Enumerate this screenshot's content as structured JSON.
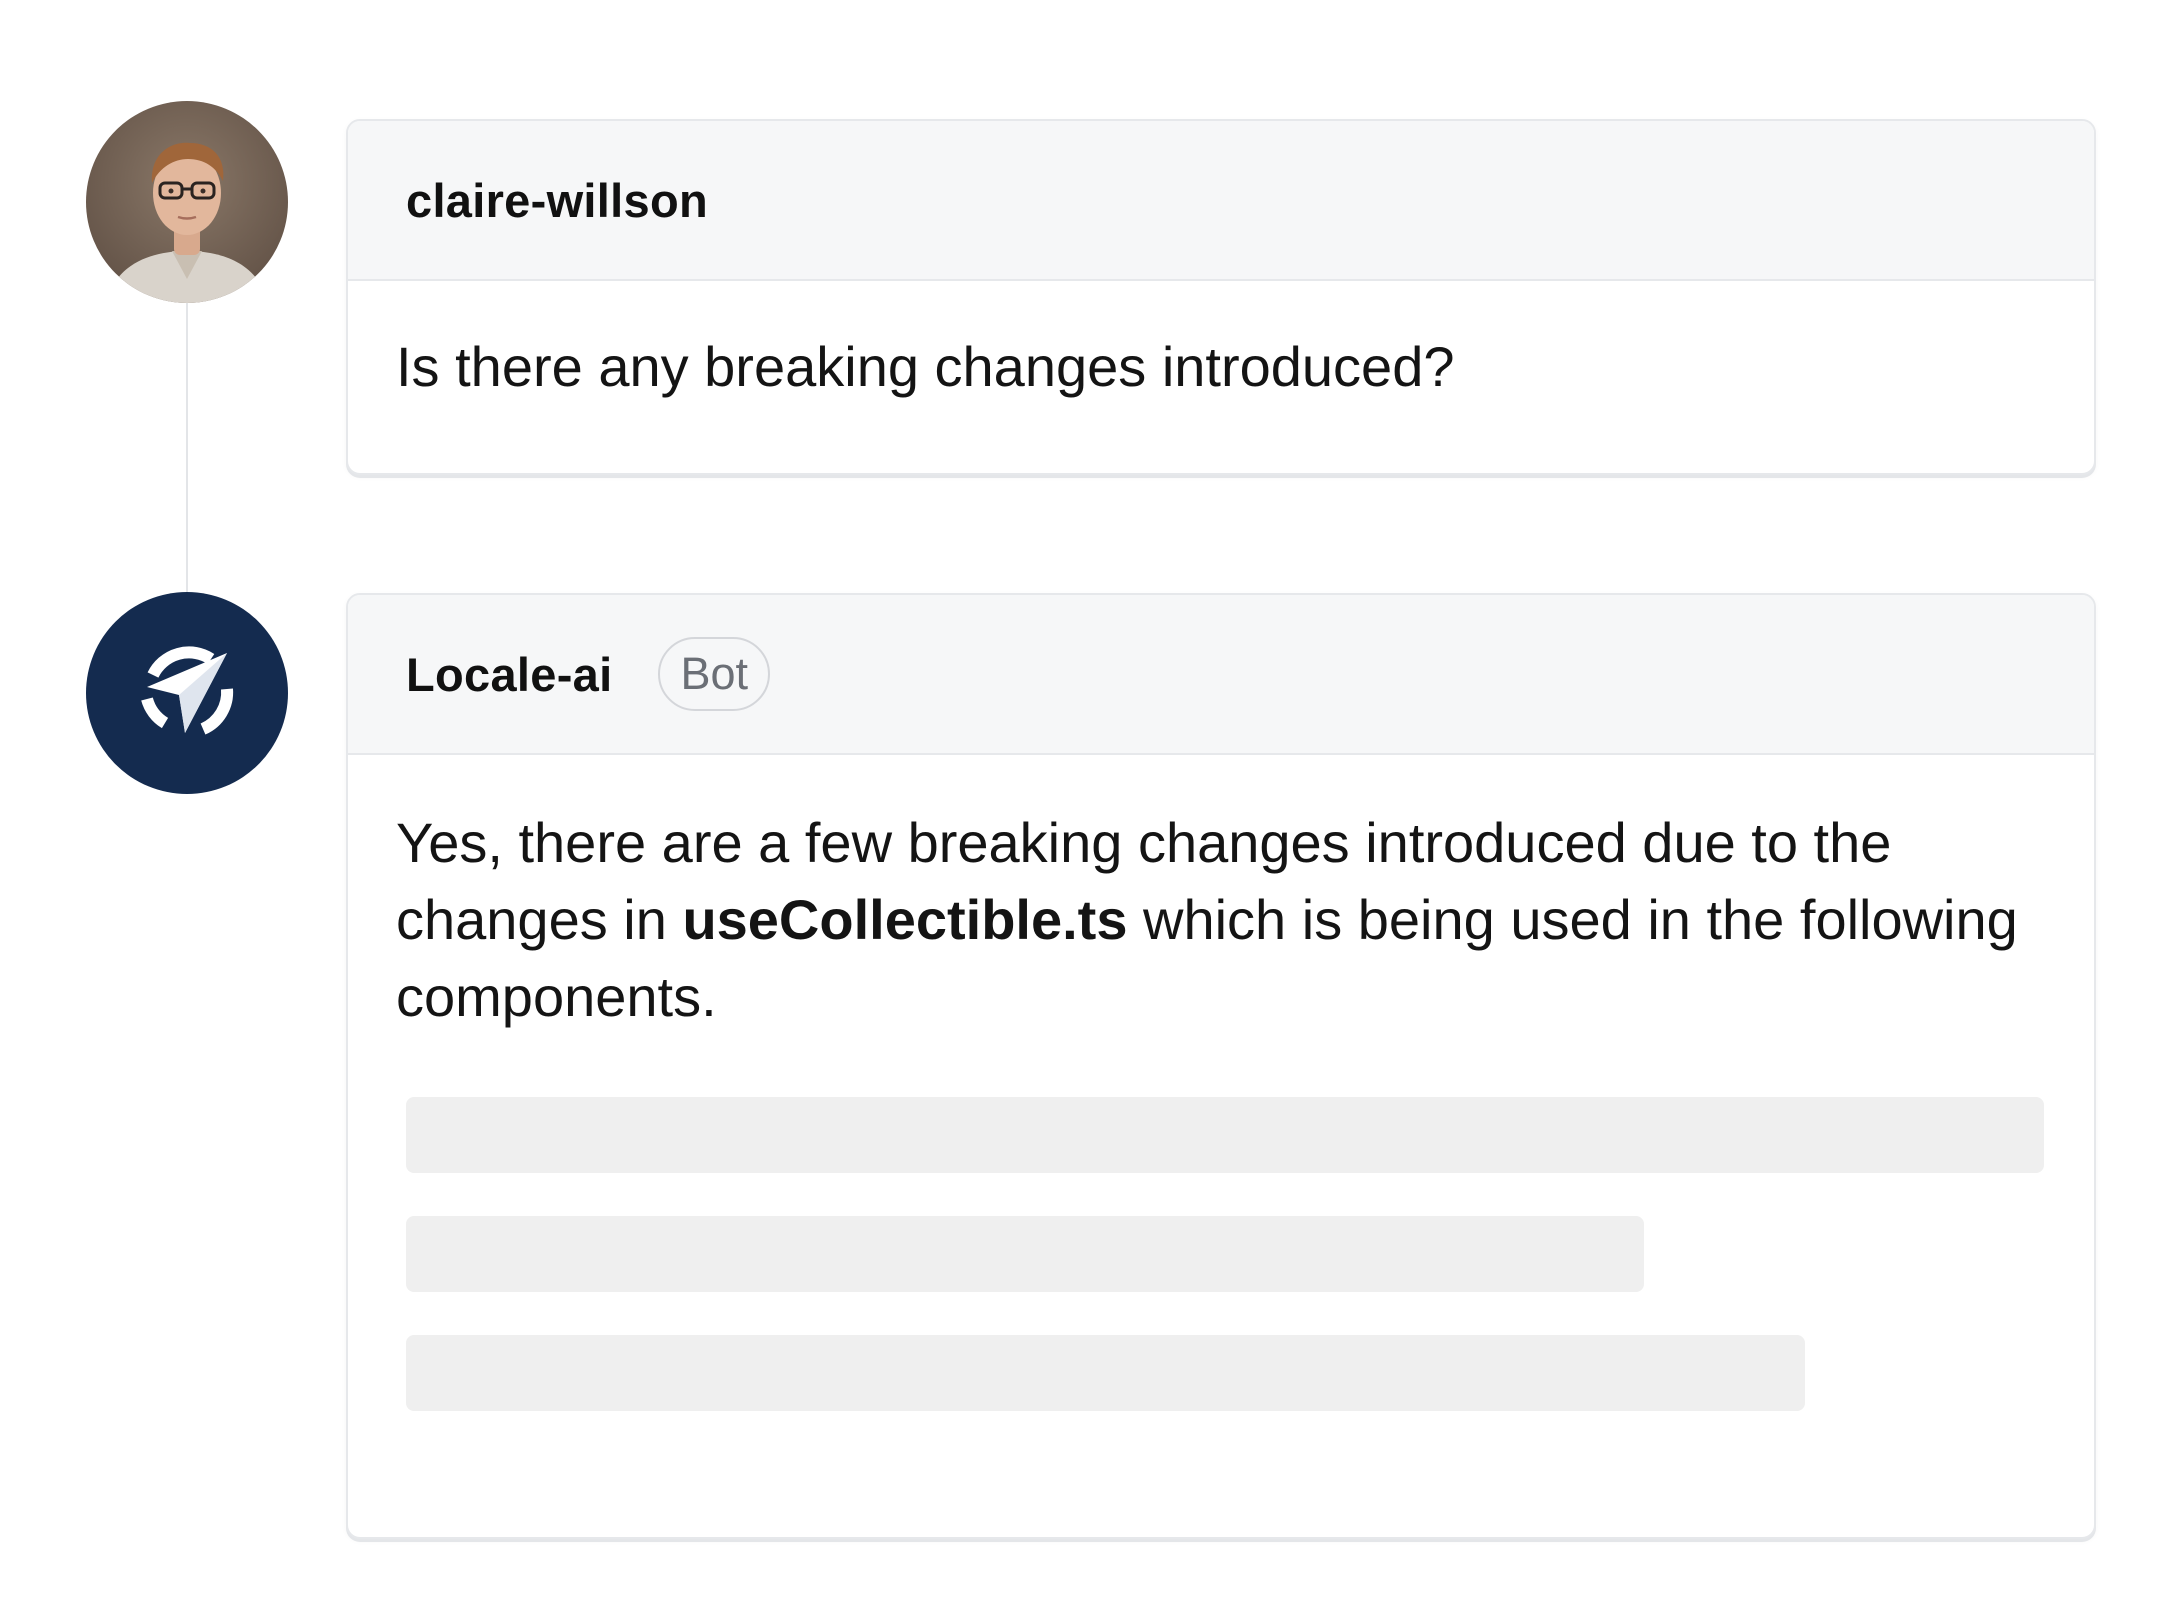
{
  "thread": {
    "messages": [
      {
        "author": "claire-willson",
        "text": "Is there any breaking changes introduced?"
      },
      {
        "author": "Locale-ai",
        "badge": "Bot",
        "text_before": "Yes, there are a few breaking changes introduced due to the changes in ",
        "text_code": "useCollectible.ts",
        "text_after": " which is being used in the following components."
      }
    ]
  },
  "icons": {
    "user_avatar": "user-avatar-photo",
    "bot_avatar": "paper-plane-compass-icon"
  },
  "colors": {
    "bot_avatar_bg": "#142b4f",
    "card_header_bg": "#f6f7f8",
    "skeleton": "#efefef"
  }
}
